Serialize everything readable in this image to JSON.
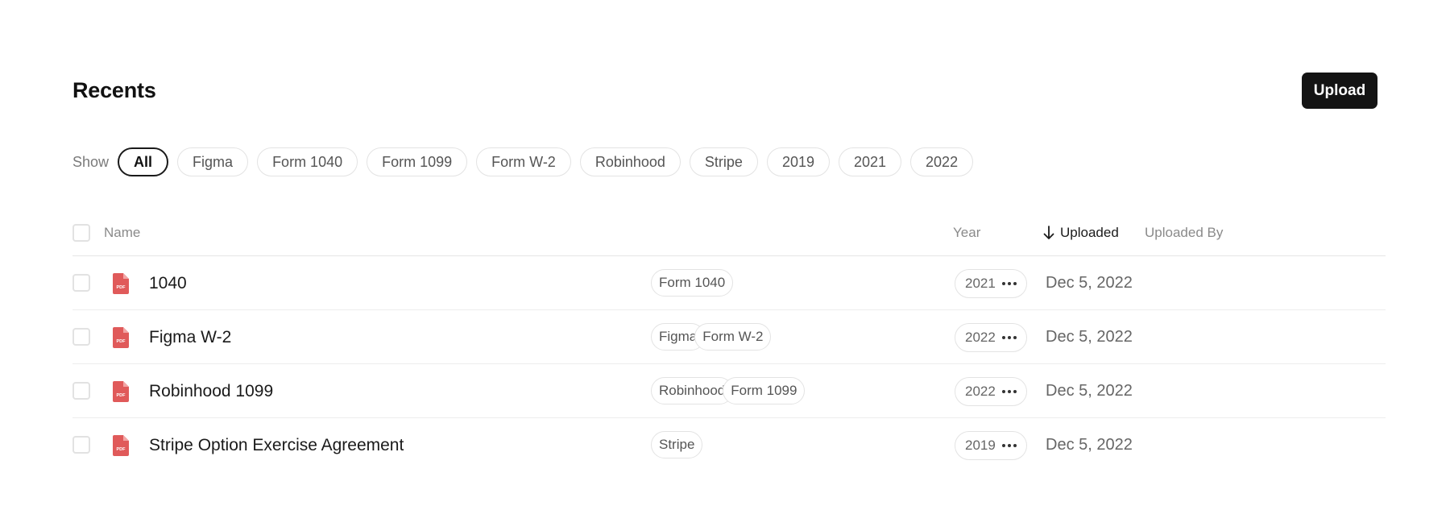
{
  "page": {
    "title": "Recents",
    "upload_label": "Upload"
  },
  "filters": {
    "show_label": "Show",
    "chips": [
      "All",
      "Figma",
      "Form 1040",
      "Form 1099",
      "Form W-2",
      "Robinhood",
      "Stripe",
      "2019",
      "2021",
      "2022"
    ],
    "active": "All"
  },
  "table": {
    "columns": {
      "name": "Name",
      "year": "Year",
      "uploaded": "Uploaded",
      "uploaded_by": "Uploaded By"
    },
    "sort": {
      "column": "Uploaded",
      "direction": "descending",
      "icon": "arrow-down-icon"
    },
    "rows": [
      {
        "name": "1040",
        "tags": [
          "Form 1040"
        ],
        "year": "2021",
        "uploaded": "Dec 5, 2022",
        "icon": "pdf-icon"
      },
      {
        "name": "Figma W-2",
        "tags": [
          "Figma",
          "Form W-2"
        ],
        "year": "2022",
        "uploaded": "Dec 5, 2022",
        "icon": "pdf-icon"
      },
      {
        "name": "Robinhood 1099",
        "tags": [
          "Robinhood",
          "Form 1099"
        ],
        "year": "2022",
        "uploaded": "Dec 5, 2022",
        "icon": "pdf-icon"
      },
      {
        "name": "Stripe Option Exercise Agreement",
        "tags": [
          "Stripe"
        ],
        "year": "2019",
        "uploaded": "Dec 5, 2022",
        "icon": "pdf-icon"
      }
    ]
  },
  "colors": {
    "pdf_icon": "#e05a5a",
    "button_bg": "#141414",
    "active_chip_border": "#1a1a1a"
  }
}
